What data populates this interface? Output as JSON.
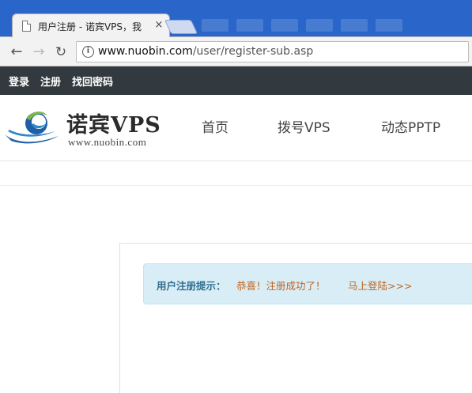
{
  "browser": {
    "tab_title": "用户注册 - 诺宾VPS，我",
    "tab_close": "×",
    "url_host": "www.nuobin.com",
    "url_path": "/user/register-sub.asp",
    "icons": {
      "back": "←",
      "forward": "→",
      "reload": "↻",
      "info": "i"
    }
  },
  "topbar": {
    "login": "登录",
    "register": "注册",
    "recover": "找回密码"
  },
  "header": {
    "logo_title": "诺宾VPS",
    "logo_sub": "www.nuobin.com",
    "menu": [
      "首页",
      "拨号VPS",
      "动态PPTP"
    ]
  },
  "notice": {
    "label": "用户注册提示：",
    "message": "恭喜！注册成功了！",
    "link": "马上登陆>>>"
  },
  "colors": {
    "tabstrip": "#2a66c9",
    "topbar": "#333a3f",
    "notice_bg": "#d9edf7",
    "notice_label": "#31708f",
    "notice_text": "#c0641b"
  }
}
